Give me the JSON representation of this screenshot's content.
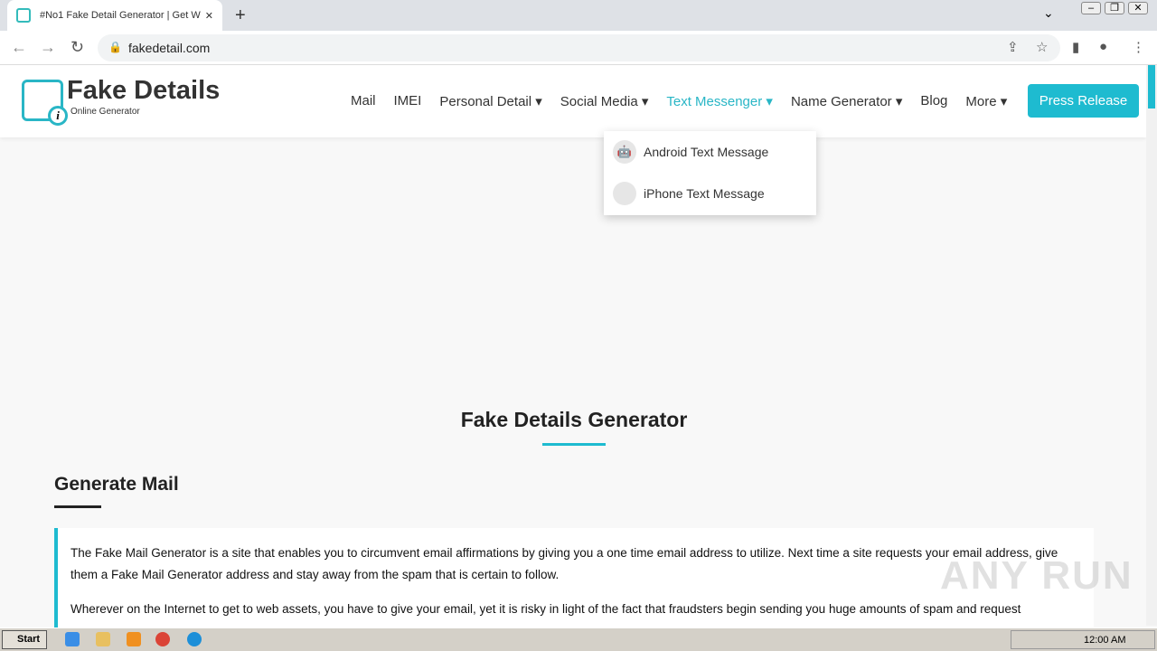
{
  "browser": {
    "tab_title": "#No1 Fake Detail Generator | Get W",
    "url": "fakedetail.com"
  },
  "site": {
    "brand": "Fake Details",
    "tagline": "Online Generator",
    "menu": [
      {
        "label": "Mail"
      },
      {
        "label": "IMEI"
      },
      {
        "label": "Personal Detail ▾"
      },
      {
        "label": "Social Media ▾"
      },
      {
        "label": "Text Messenger ▾",
        "active": true
      },
      {
        "label": "Name Generator ▾"
      },
      {
        "label": "Blog"
      },
      {
        "label": "More ▾"
      }
    ],
    "press_release": "Press Release",
    "dropdown": [
      {
        "label": "Android Text Message",
        "icon": "android-icon"
      },
      {
        "label": "iPhone Text Message",
        "icon": "apple-icon"
      }
    ]
  },
  "main": {
    "title": "Fake Details Generator",
    "section": "Generate Mail",
    "paragraphs": [
      "The Fake Mail Generator is a site that enables you to circumvent email affirmations by giving you a one time email address to utilize. Next time a site requests your email address, give them a Fake Mail Generator address and stay away from the spam that is certain to follow.",
      "Wherever on the Internet to get to web assets, you have to give your email, yet it is risky in light of the fact that fraudsters begin sending you huge amounts of spam and request"
    ]
  },
  "watermark": "ANY RUN",
  "taskbar": {
    "start": "Start",
    "clock": "12:00 AM"
  },
  "colors": {
    "accent": "#1ebbd0"
  }
}
